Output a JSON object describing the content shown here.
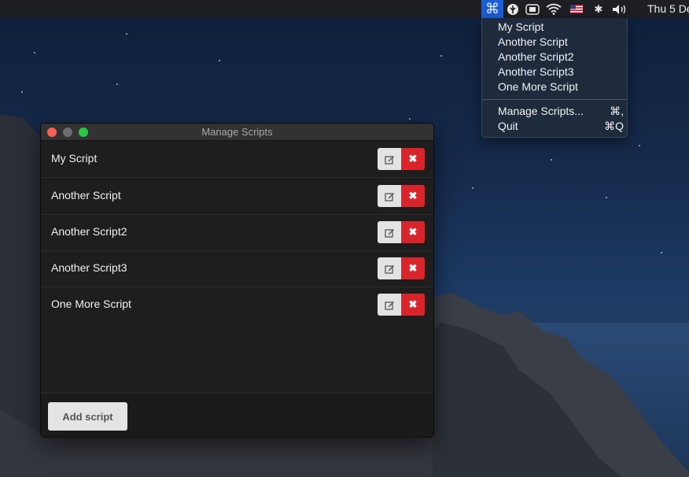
{
  "menubar": {
    "icons": [
      "command-icon",
      "leaf-icon",
      "display-icon",
      "wifi-icon",
      "us-flag-icon",
      "bluetooth-icon",
      "volume-icon"
    ],
    "clock": "Thu 5 De"
  },
  "dropdown": {
    "scripts": [
      "My Script",
      "Another Script",
      "Another Script2",
      "Another Script3",
      "One More Script"
    ],
    "manage_label": "Manage Scripts...",
    "manage_shortcut": "⌘,",
    "quit_label": "Quit",
    "quit_shortcut": "⌘Q"
  },
  "window": {
    "title": "Manage Scripts",
    "scripts": [
      "My Script",
      "Another Script",
      "Another Script2",
      "Another Script3",
      "One More Script"
    ],
    "add_label": "Add script"
  },
  "colors": {
    "accent": "#1a5fd6",
    "delete": "#d9252a",
    "close": "#fe5f57",
    "maximize": "#28c840"
  }
}
